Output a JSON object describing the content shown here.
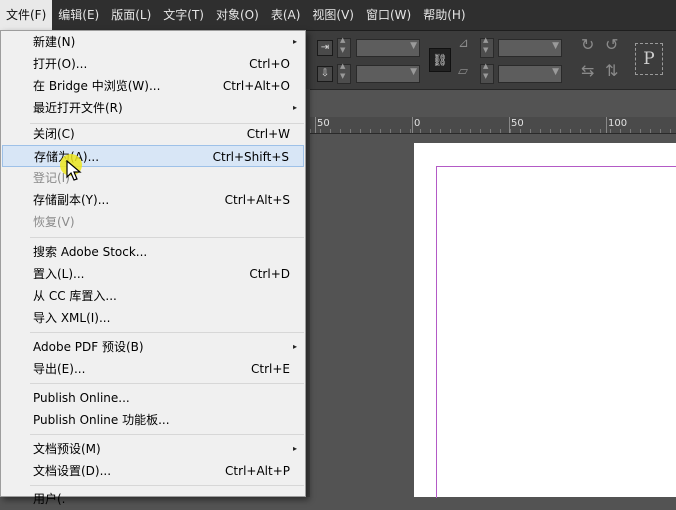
{
  "menubar": {
    "items": [
      "文件(F)",
      "编辑(E)",
      "版面(L)",
      "文字(T)",
      "对象(O)",
      "表(A)",
      "视图(V)",
      "窗口(W)",
      "帮助(H)"
    ]
  },
  "file_menu": {
    "items": [
      {
        "label": "新建(N)",
        "shortcut": "",
        "submenu": "▸"
      },
      {
        "label": "打开(O)...",
        "shortcut": "Ctrl+O"
      },
      {
        "label": "在 Bridge 中浏览(W)...",
        "shortcut": "Ctrl+Alt+O"
      },
      {
        "label": "最近打开文件(R)",
        "shortcut": "",
        "submenu": "▸"
      },
      {
        "label": "关闭(C)",
        "shortcut": "Ctrl+W"
      },
      {
        "label": "存储为(A)...",
        "shortcut": "Ctrl+Shift+S"
      },
      {
        "label": "登记(I)",
        "shortcut": ""
      },
      {
        "label": "存储副本(Y)...",
        "shortcut": "Ctrl+Alt+S"
      },
      {
        "label": "恢复(V)",
        "shortcut": ""
      },
      {
        "label": "搜索 Adobe Stock...",
        "shortcut": ""
      },
      {
        "label": "置入(L)...",
        "shortcut": "Ctrl+D"
      },
      {
        "label": "从 CC 库置入...",
        "shortcut": ""
      },
      {
        "label": "导入 XML(I)...",
        "shortcut": ""
      },
      {
        "label": "Adobe PDF 预设(B)",
        "shortcut": "",
        "submenu": "▸"
      },
      {
        "label": "导出(E)...",
        "shortcut": "Ctrl+E"
      },
      {
        "label": "Publish Online...",
        "shortcut": ""
      },
      {
        "label": "Publish Online 功能板...",
        "shortcut": ""
      },
      {
        "label": "文档预设(M)",
        "shortcut": "",
        "submenu": "▸"
      },
      {
        "label": "文档设置(D)...",
        "shortcut": "Ctrl+Alt+P"
      },
      {
        "label": "用户(.",
        "shortcut": ""
      }
    ]
  },
  "ruler": {
    "ticks": [
      "50",
      "0",
      "50",
      "100"
    ]
  },
  "control_panel": {
    "p_label": "P"
  },
  "colors": {
    "menubar_bg": "#2f2f2f",
    "menu_bg": "#f0f0f0",
    "hover_bg": "#d8e6f6",
    "margin_guide": "#b35ac6",
    "workspace_bg": "#535353"
  }
}
